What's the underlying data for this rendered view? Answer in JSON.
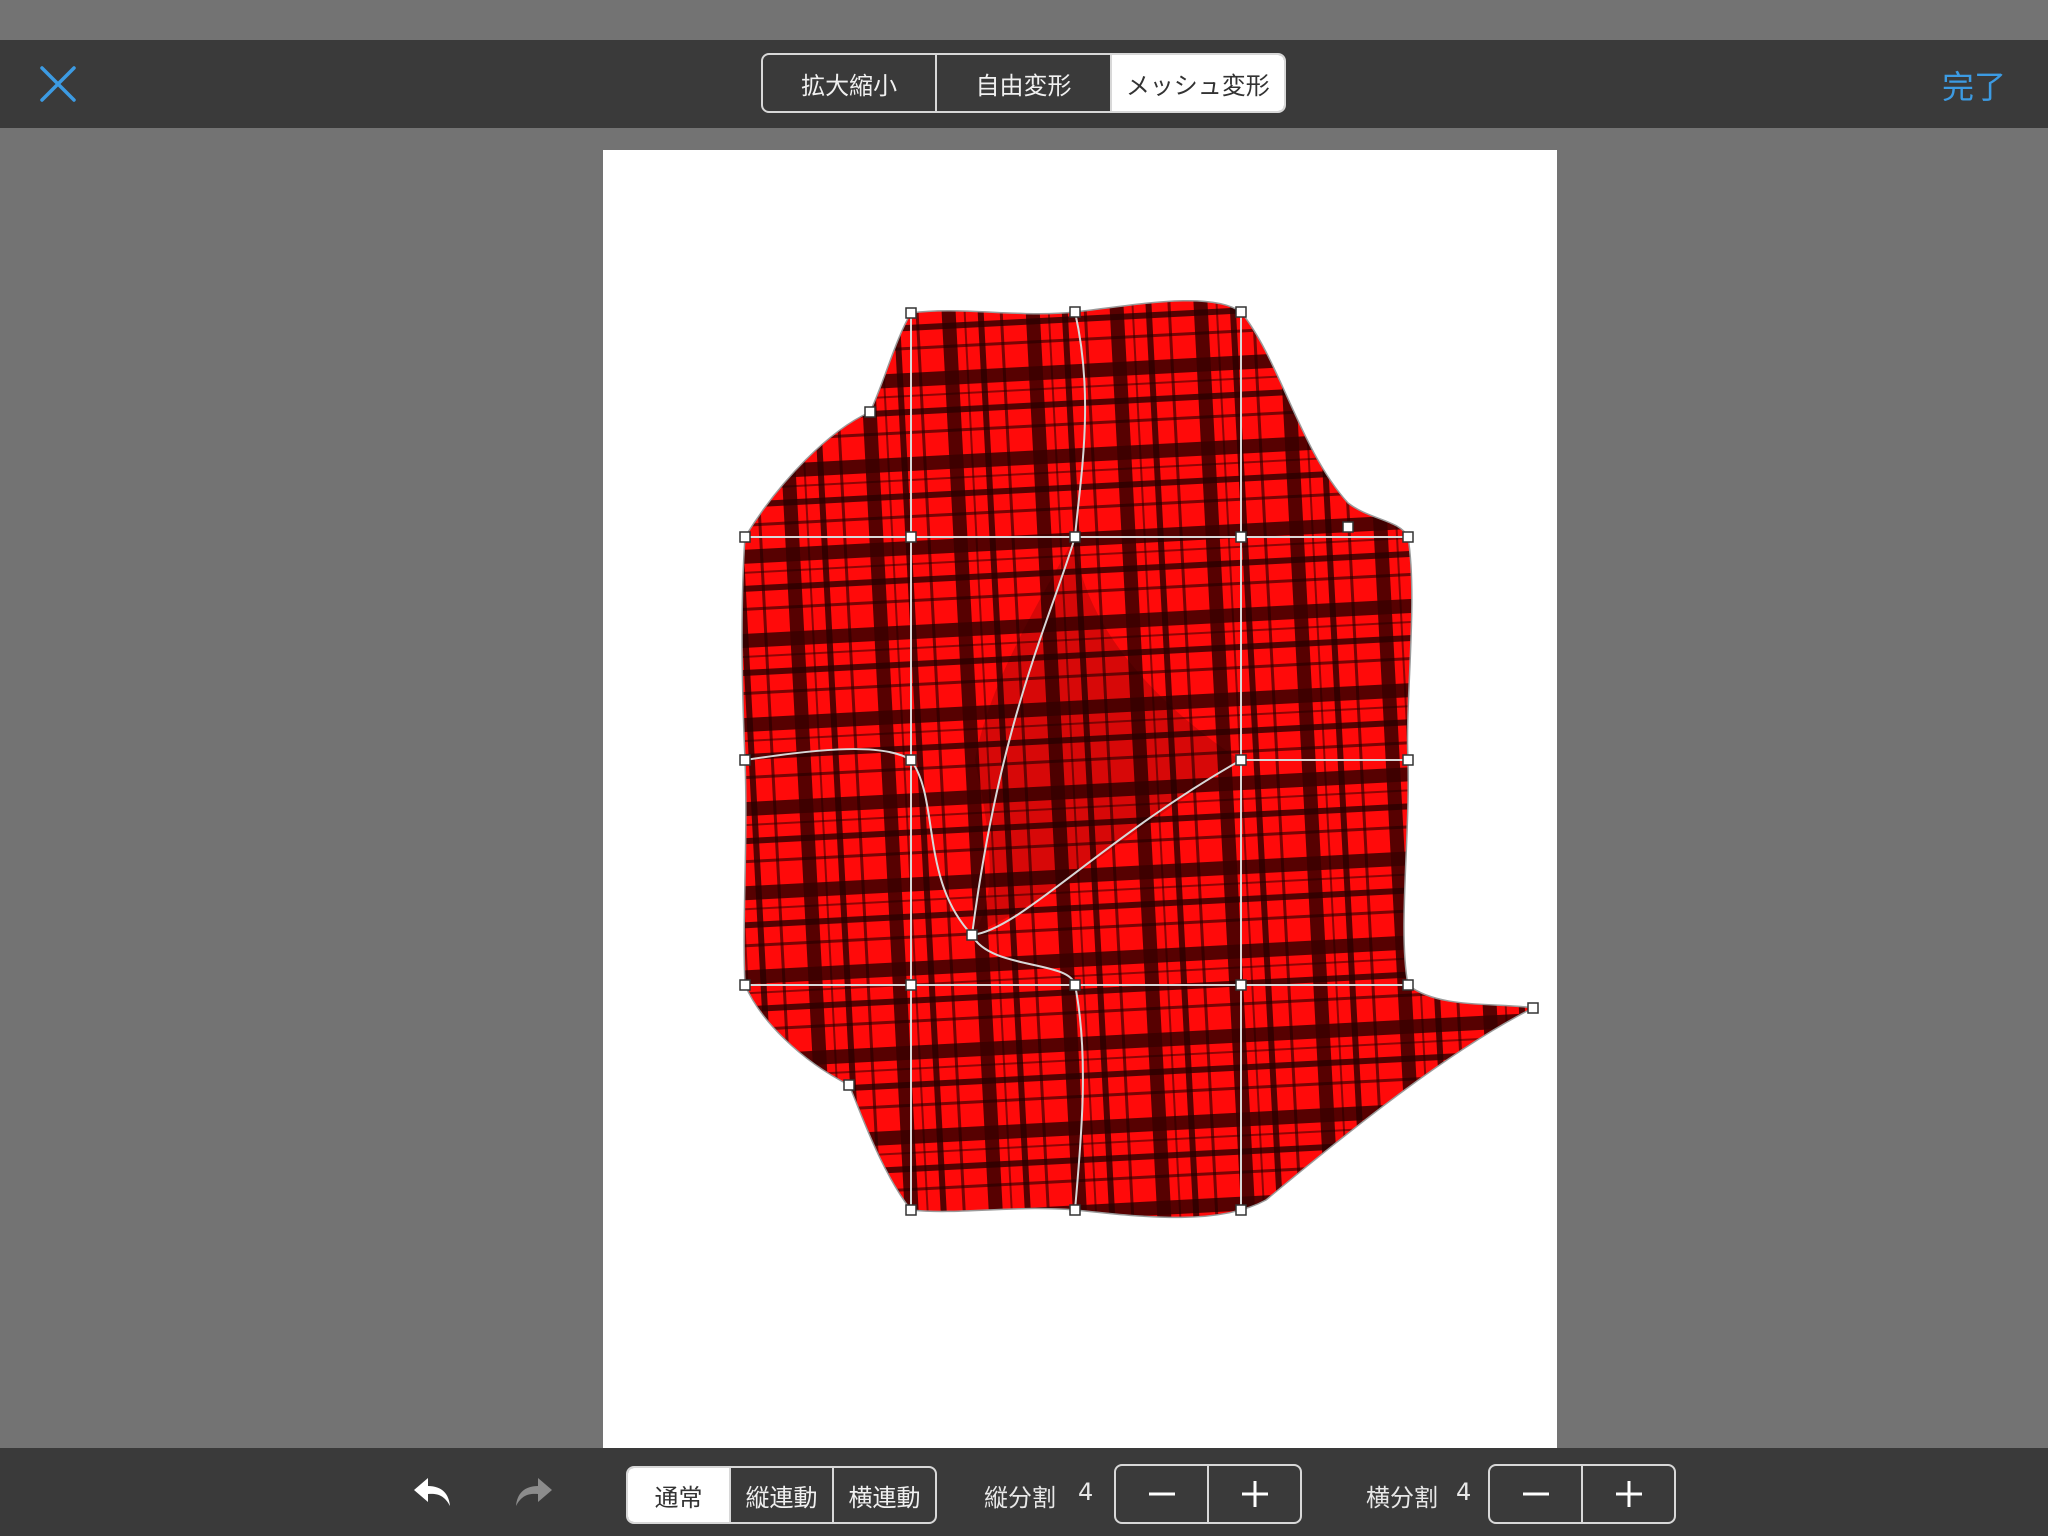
{
  "toolbar": {
    "close_icon": "close-icon",
    "modes": [
      "拡大縮小",
      "自由変形",
      "メッシュ変形"
    ],
    "active_mode": "メッシュ変形",
    "done_label": "完了"
  },
  "canvas": {
    "pattern": "red-black tartan plaid",
    "colors": {
      "plaid_red": "#ff0000",
      "plaid_dark": "#1a0000",
      "mesh_line": "#cfcfcf",
      "handle": "#ffffff"
    }
  },
  "bottom_bar": {
    "undo_icon": "undo-icon",
    "redo_icon": "redo-icon",
    "link_modes": [
      "通常",
      "縦連動",
      "横連動"
    ],
    "active_link_mode": "通常",
    "vertical_division": {
      "label": "縦分割",
      "value": "4"
    },
    "horizontal_division": {
      "label": "横分割",
      "value": "4"
    },
    "minus_icon": "minus-icon",
    "plus_icon": "plus-icon"
  },
  "theme": {
    "accent": "#3c9be3",
    "bar_bg": "#3a3a3a",
    "workspace_bg": "#737373"
  }
}
